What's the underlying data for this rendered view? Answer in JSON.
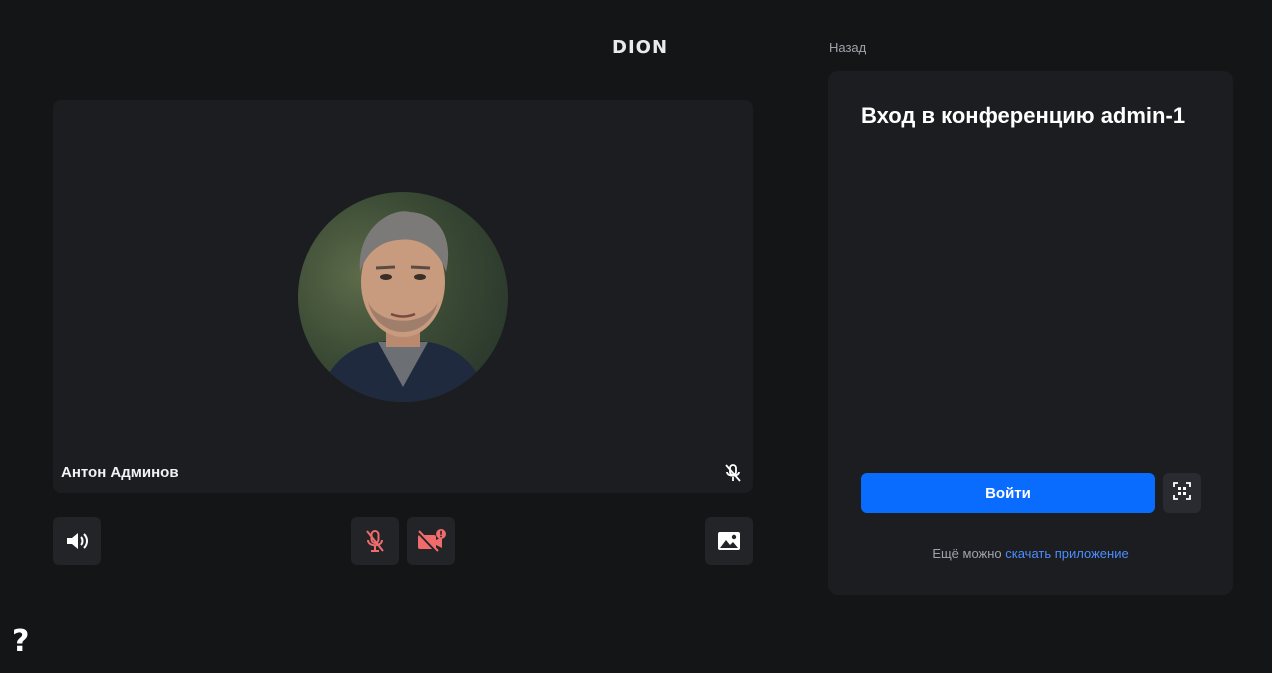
{
  "header": {
    "logo_text": "DION",
    "back_label": "Назад"
  },
  "video": {
    "participant_name": "Антон Админов",
    "icons": {
      "tile_mic": "mic-off-icon",
      "speaker": "speaker-icon",
      "mic_toggle": "mic-off-icon",
      "camera_toggle": "camera-off-warning-icon",
      "background": "image-icon"
    },
    "colors": {
      "muted_red": "#f06b6b",
      "control_bg": "#232428"
    }
  },
  "panel": {
    "title": "Вход в конференцию admin-1",
    "join_label": "Войти",
    "download_prefix": "Ещё можно ",
    "download_link": "скачать приложение",
    "qr_icon": "qr-scan-icon",
    "colors": {
      "accent": "#0a6cff",
      "link": "#4c8dff"
    }
  },
  "help": {
    "label": "?"
  }
}
